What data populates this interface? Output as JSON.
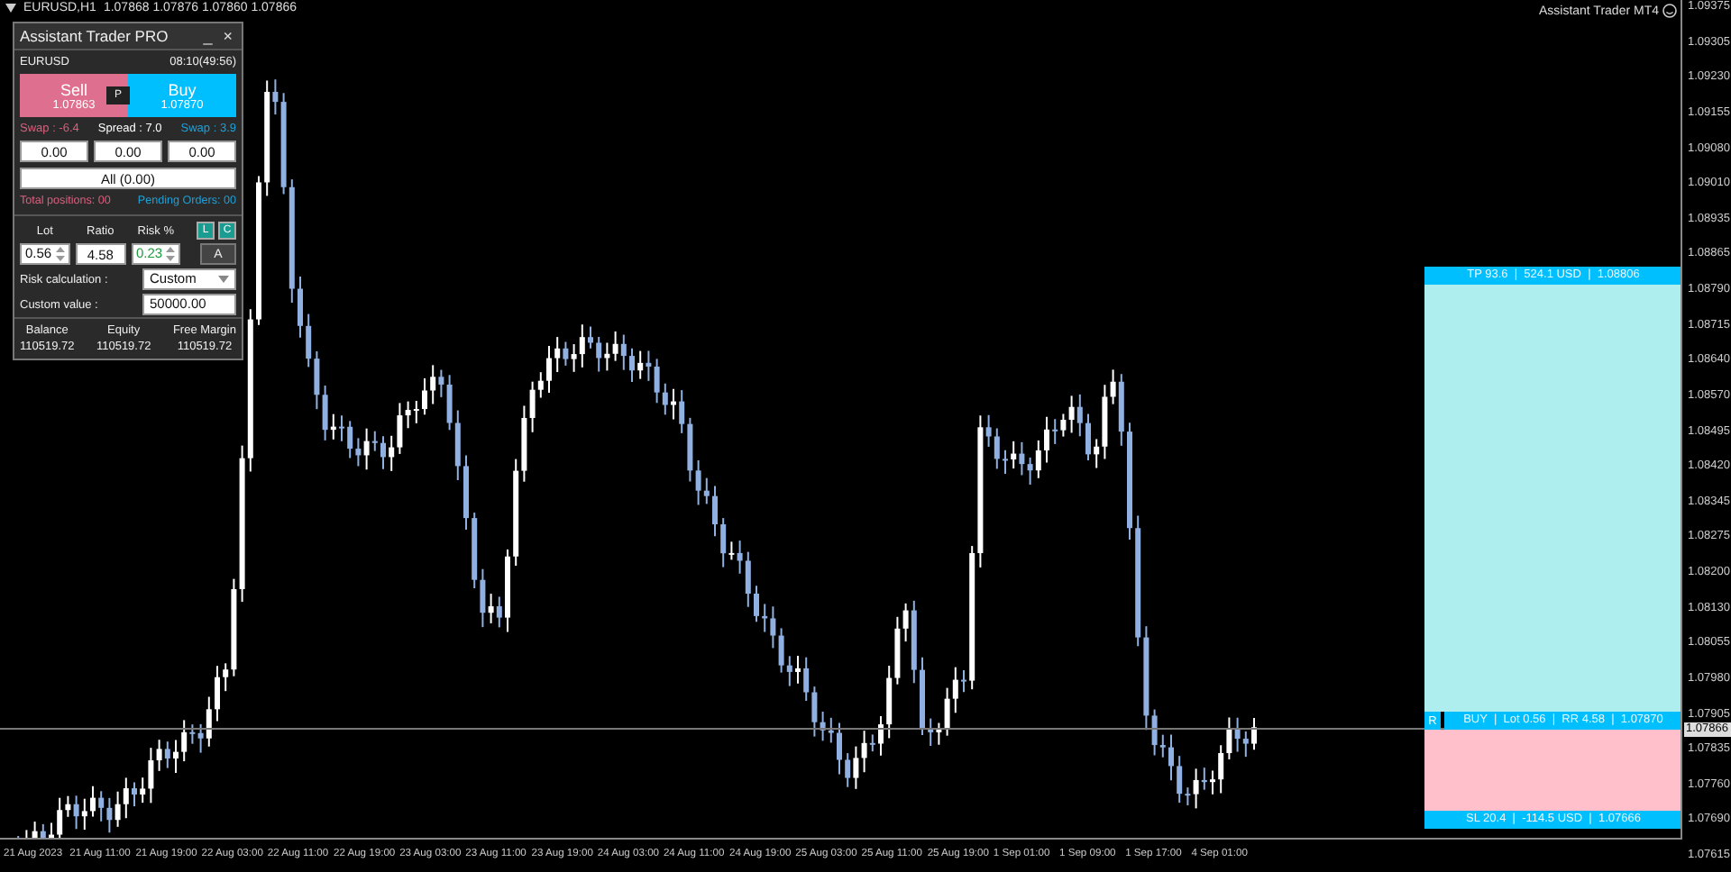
{
  "chart_header": {
    "symbol": "EURUSD,H1",
    "ohlc": "1.07868 1.07876 1.07860 1.07866"
  },
  "indicator_label": "Assistant Trader MT4",
  "price_axis": [
    "1.09375",
    "1.09305",
    "1.09230",
    "1.09155",
    "1.09080",
    "1.09010",
    "1.08935",
    "1.08865",
    "1.08790",
    "1.08715",
    "1.08640",
    "1.08570",
    "1.08495",
    "1.08420",
    "1.08345",
    "1.08275",
    "1.08200",
    "1.08130",
    "1.08055",
    "1.07980",
    "1.07905",
    "1.07835",
    "1.07760",
    "1.07690",
    "1.07615"
  ],
  "current_price": "1.07866",
  "time_axis": [
    "21 Aug 2023",
    "21 Aug 11:00",
    "21 Aug 19:00",
    "22 Aug 03:00",
    "22 Aug 11:00",
    "22 Aug 19:00",
    "23 Aug 03:00",
    "23 Aug 11:00",
    "23 Aug 19:00",
    "24 Aug 03:00",
    "24 Aug 11:00",
    "24 Aug 19:00",
    "25 Aug 03:00",
    "25 Aug 11:00",
    "25 Aug 19:00",
    "1 Sep 01:00",
    "1 Sep 09:00",
    "1 Sep 17:00",
    "4 Sep 01:00"
  ],
  "trade_zone": {
    "tp": "TP 93.6  |  524.1 USD  |  1.08806",
    "r_button": "R",
    "entry": "BUY  |  Lot 0.56  |  RR 4.58  |  1.07870",
    "sl": "SL 20.4  |  -114.5 USD  |  1.07666"
  },
  "panel": {
    "title": "Assistant Trader PRO",
    "minimize": "_",
    "close": "×",
    "symbol": "EURUSD",
    "time": "08:10(49:56)",
    "sell": {
      "label": "Sell",
      "price": "1.07863"
    },
    "p_button": "P",
    "buy": {
      "label": "Buy",
      "price": "1.07870"
    },
    "stats": [
      {
        "text": "Swap : -6.4",
        "color": "#d8607e"
      },
      {
        "text": "Spread : 7.0",
        "color": "#ffffff"
      },
      {
        "text": "Swap : 3.9",
        "color": "#1ea0d8"
      }
    ],
    "amounts": [
      "0.00",
      "0.00",
      "0.00"
    ],
    "all_button": "All (0.00)",
    "counts": [
      {
        "text": "Total positions: 00",
        "color": "#d8607e"
      },
      {
        "text": "Pending Orders: 00",
        "color": "#1ea0d8"
      }
    ],
    "lot": {
      "label": "Lot",
      "value": "0.56"
    },
    "ratio": {
      "label": "Ratio",
      "value": "4.58"
    },
    "risk": {
      "label": "Risk %",
      "value": "0.23"
    },
    "l_button": "L",
    "c_button": "C",
    "a_button": "A",
    "risk_calc": {
      "label": "Risk calculation :",
      "value": "Custom"
    },
    "custom_value": {
      "label": "Custom value :",
      "value": "50000.00"
    },
    "account": [
      {
        "label": "Balance",
        "value": "110519.72"
      },
      {
        "label": "Equity",
        "value": "110519.72"
      },
      {
        "label": "Free Margin",
        "value": "110519.72"
      }
    ]
  }
}
